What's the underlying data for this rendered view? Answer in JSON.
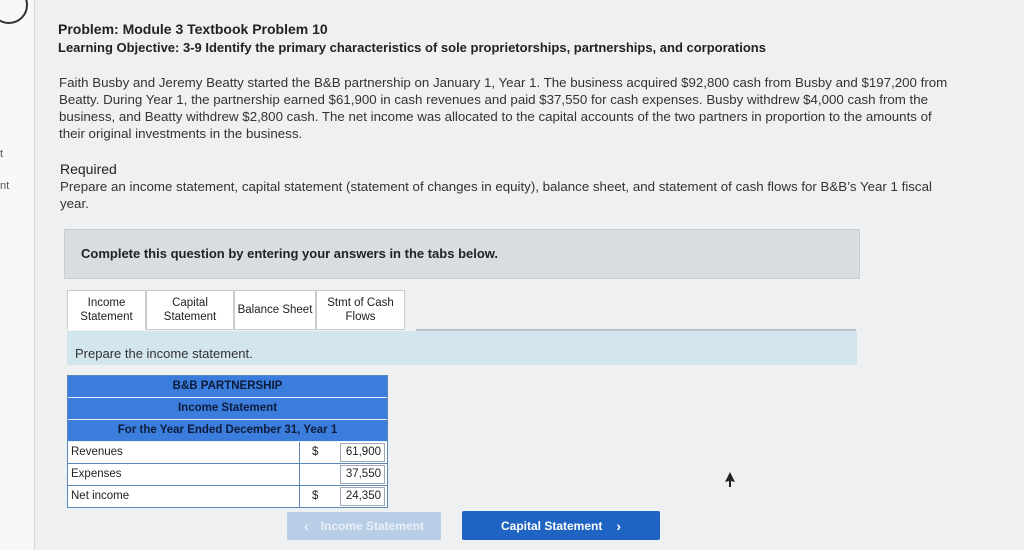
{
  "sidebar": {
    "labels": [
      "t",
      "nt"
    ]
  },
  "problem": {
    "title": "Problem: Module 3 Textbook Problem 10",
    "learning_objective": "Learning Objective: 3-9 Identify the primary characteristics of sole proprietorships, partnerships, and corporations",
    "text": "Faith Busby and Jeremy Beatty started the B&B partnership on January 1, Year 1. The business acquired $92,800 cash from Busby and $197,200 from Beatty. During Year 1, the partnership earned $61,900 in cash revenues and paid $37,550 for cash expenses. Busby withdrew $4,000 cash from the business, and Beatty withdrew $2,800 cash. The net income was allocated to the capital accounts of the two partners in proportion to the amounts of their original investments in the business."
  },
  "required": {
    "title": "Required",
    "text": "Prepare an income statement, capital statement (statement of changes in equity), balance sheet, and statement of cash flows for B&B’s Year 1 fiscal year."
  },
  "instructions": "Complete this question by entering your answers in the tabs below.",
  "tabs": [
    {
      "label": "Income\nStatement"
    },
    {
      "label": "Capital\nStatement"
    },
    {
      "label": "Balance Sheet"
    },
    {
      "label": "Stmt of Cash\nFlows"
    }
  ],
  "section_prompt": "Prepare the income statement.",
  "statement": {
    "company": "B&B PARTNERSHIP",
    "name": "Income Statement",
    "period": "For the Year Ended December 31, Year 1",
    "rows": [
      {
        "label": "Revenues",
        "currency": "$",
        "value": "61,900"
      },
      {
        "label": "Expenses",
        "currency": "",
        "value": "37,550"
      },
      {
        "label": "Net income",
        "currency": "$",
        "value": "24,350"
      }
    ]
  },
  "nav": {
    "prev_label": "Income Statement",
    "next_label": "Capital Statement",
    "prev_icon": "chevron-left-icon",
    "next_icon": "chevron-right-icon"
  },
  "colors": {
    "accent": "#1f63c3",
    "table_header": "#3b7ddd",
    "section_bar": "#d3e6ee"
  }
}
